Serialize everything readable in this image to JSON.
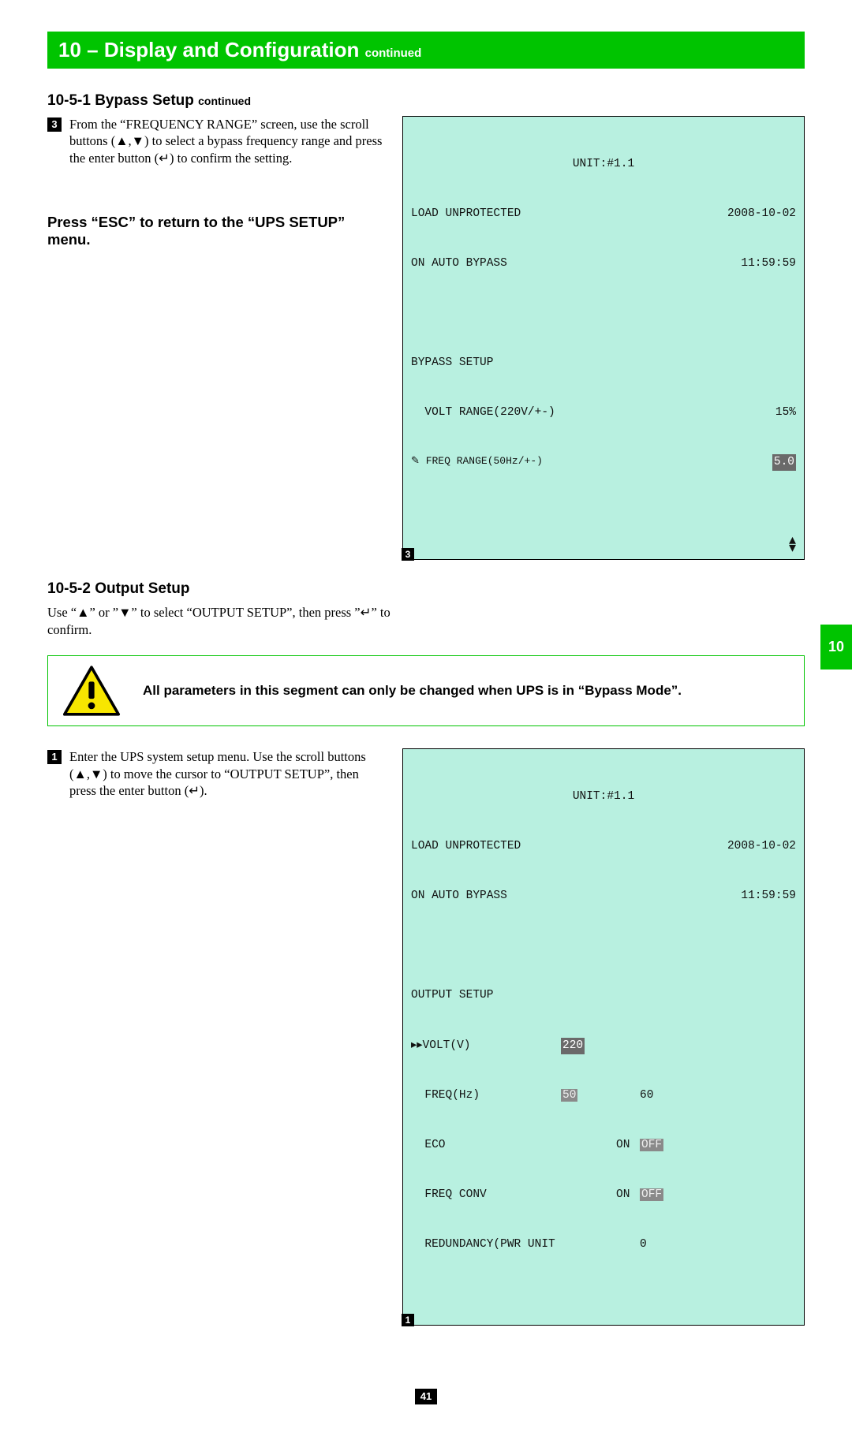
{
  "header": {
    "title": "10 – Display and Configuration",
    "continued": "continued"
  },
  "section1": {
    "title": "10-5-1 Bypass Setup",
    "continued": "continued",
    "step3_num": "3",
    "step3_text": "From the “FREQUENCY RANGE” screen, use the scroll buttons (▲,▼) to select a bypass frequency range and press the enter button (↵) to confirm the setting.",
    "esc_note": "Press “ESC” to return to the “UPS SETUP” menu."
  },
  "screen1": {
    "caption": "3",
    "unit": "UNIT:#1.1",
    "status1_l": "LOAD UNPROTECTED",
    "status1_r": "2008-10-02",
    "status2_l": "ON AUTO BYPASS",
    "status2_r": "11:59:59",
    "menu_title": "BYPASS SETUP",
    "row1_l": "  VOLT RANGE(220V/+-)",
    "row1_r": "15%",
    "row2_l": "✎ FREQ RANGE(50Hz/+-)",
    "row2_r": "5.0"
  },
  "section2": {
    "title": "10-5-2 Output Setup",
    "intro": "Use “▲” or ”▼” to select “OUTPUT SETUP”, then press ”↵” to confirm.",
    "warning": "All parameters in this segment can only be changed when UPS is in “Bypass Mode”.",
    "step1_num": "1",
    "step1_text": "Enter the UPS system setup menu. Use the scroll buttons (▲,▼) to move the cursor to “OUTPUT SETUP”, then press the enter button (↵)."
  },
  "screen2": {
    "caption": "1",
    "unit": "UNIT:#1.1",
    "status1_l": "LOAD UNPROTECTED",
    "status1_r": "2008-10-02",
    "status2_l": "ON AUTO BYPASS",
    "status2_r": "11:59:59",
    "menu_title": "OUTPUT SETUP",
    "r1_l": "▸▸VOLT(V)",
    "r1_v1": "220",
    "r2_l": "  FREQ(Hz)",
    "r2_v1": "50",
    "r2_v2": "60",
    "r3_l": "  ECO",
    "r3_v1": "ON",
    "r3_v2": "OFF",
    "r4_l": "  FREQ CONV",
    "r4_v1": "ON",
    "r4_v2": "OFF",
    "r5_l": "  REDUNDANCY(PWR UNIT",
    "r5_v": "0"
  },
  "side_tab": "10",
  "page_number": "41"
}
